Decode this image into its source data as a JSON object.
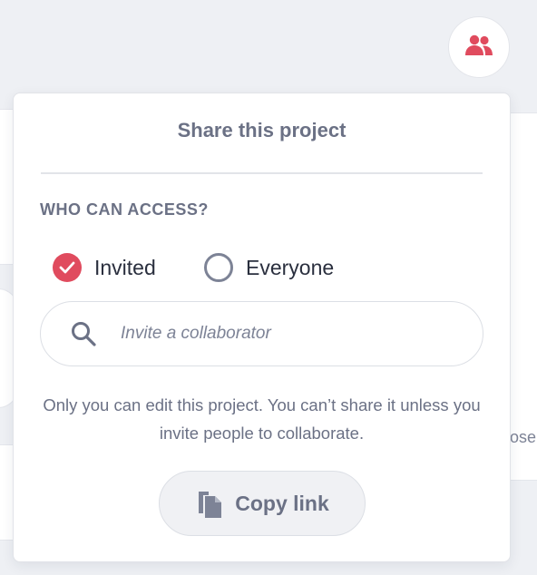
{
  "header": {
    "share_button_icon": "people-icon",
    "accent_color": "#e04b5e"
  },
  "background": {
    "partial_text": "ose"
  },
  "share_popover": {
    "title": "Share this project",
    "access": {
      "label": "WHO CAN ACCESS?",
      "options": [
        {
          "label": "Invited",
          "checked": true
        },
        {
          "label": "Everyone",
          "checked": false
        }
      ]
    },
    "search": {
      "placeholder": "Invite a collaborator",
      "value": "",
      "icon": "search-icon"
    },
    "note": "Only you can edit this project. You can’t share it unless you invite people to collaborate.",
    "copy_link": {
      "label": "Copy link",
      "icon": "copy-icon"
    }
  }
}
